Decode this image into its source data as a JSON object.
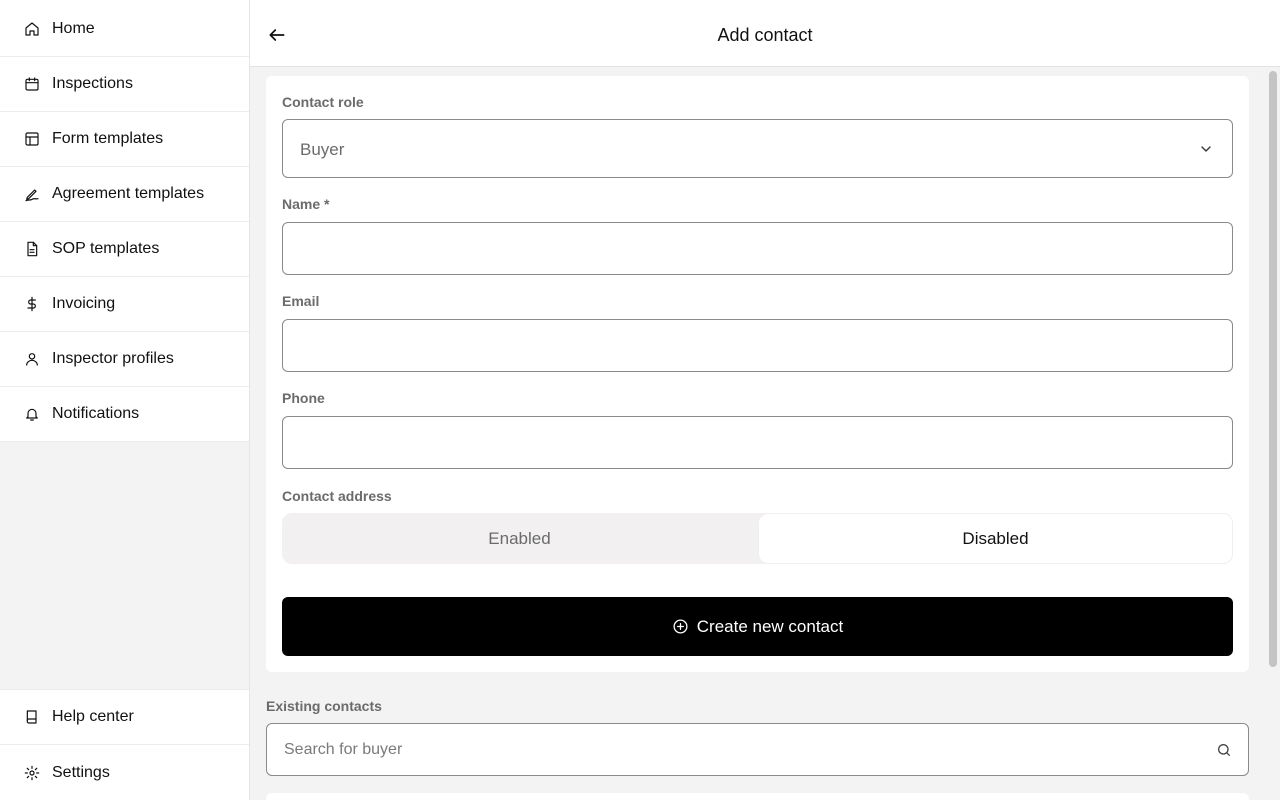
{
  "sidebar": {
    "items": [
      {
        "label": "Home",
        "icon": "home-icon"
      },
      {
        "label": "Inspections",
        "icon": "calendar-icon"
      },
      {
        "label": "Form templates",
        "icon": "layout-icon"
      },
      {
        "label": "Agreement templates",
        "icon": "signature-icon"
      },
      {
        "label": "SOP templates",
        "icon": "document-icon"
      },
      {
        "label": "Invoicing",
        "icon": "dollar-icon"
      },
      {
        "label": "Inspector profiles",
        "icon": "user-icon"
      },
      {
        "label": "Notifications",
        "icon": "bell-icon"
      }
    ],
    "bottom_items": [
      {
        "label": "Help center",
        "icon": "book-icon"
      },
      {
        "label": "Settings",
        "icon": "gear-icon"
      }
    ]
  },
  "header": {
    "title": "Add contact",
    "back_icon": "arrow-left-icon"
  },
  "form": {
    "contact_role_label": "Contact role",
    "contact_role_value": "Buyer",
    "name_label": "Name *",
    "name_value": "",
    "email_label": "Email",
    "email_value": "",
    "phone_label": "Phone",
    "phone_value": "",
    "contact_address_label": "Contact address",
    "address_options": [
      "Enabled",
      "Disabled"
    ],
    "address_selected": "Disabled",
    "create_button_label": "Create new contact"
  },
  "existing": {
    "label": "Existing contacts",
    "search_placeholder": "Search for buyer",
    "search_value": ""
  },
  "colors": {
    "primary_button": "#000000",
    "sidebar_bg": "#f4f3f3",
    "label_gray": "#6b6b6b"
  }
}
